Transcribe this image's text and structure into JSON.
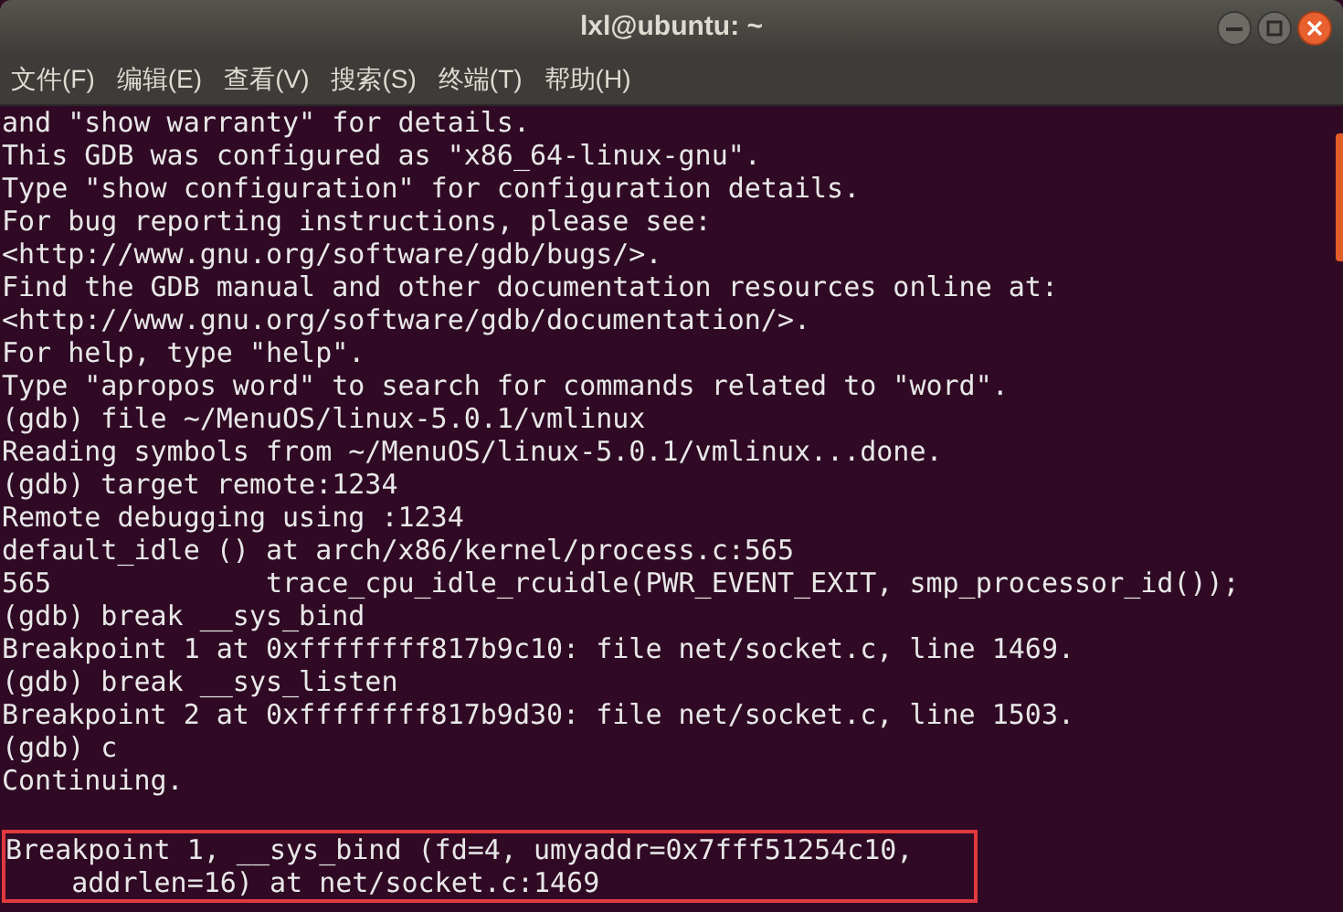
{
  "window": {
    "title": "lxl@ubuntu: ~"
  },
  "menu": [
    {
      "label": "文件(F)"
    },
    {
      "label": "编辑(E)"
    },
    {
      "label": "查看(V)"
    },
    {
      "label": "搜索(S)"
    },
    {
      "label": "终端(T)"
    },
    {
      "label": "帮助(H)"
    }
  ],
  "terminal": {
    "lines": [
      {
        "kind": "text",
        "text": "and \"show warranty\" for details."
      },
      {
        "kind": "text",
        "text": "This GDB was configured as \"x86_64-linux-gnu\"."
      },
      {
        "kind": "text",
        "text": "Type \"show configuration\" for configuration details."
      },
      {
        "kind": "text",
        "text": "For bug reporting instructions, please see:"
      },
      {
        "kind": "text",
        "text": "<http://www.gnu.org/software/gdb/bugs/>."
      },
      {
        "kind": "text",
        "text": "Find the GDB manual and other documentation resources online at:"
      },
      {
        "kind": "text",
        "text": "<http://www.gnu.org/software/gdb/documentation/>."
      },
      {
        "kind": "text",
        "text": "For help, type \"help\"."
      },
      {
        "kind": "text",
        "text": "Type \"apropos word\" to search for commands related to \"word\"."
      },
      {
        "kind": "text",
        "text": "(gdb) file ~/MenuOS/linux-5.0.1/vmlinux"
      },
      {
        "kind": "text",
        "text": "Reading symbols from ~/MenuOS/linux-5.0.1/vmlinux...done."
      },
      {
        "kind": "text",
        "text": "(gdb) target remote:1234"
      },
      {
        "kind": "text",
        "text": "Remote debugging using :1234"
      },
      {
        "kind": "text",
        "text": "default_idle () at arch/x86/kernel/process.c:565"
      },
      {
        "kind": "text",
        "text": "565\t\ttrace_cpu_idle_rcuidle(PWR_EVENT_EXIT, smp_processor_id());"
      },
      {
        "kind": "text",
        "text": "(gdb) break __sys_bind"
      },
      {
        "kind": "text",
        "text": "Breakpoint 1 at 0xffffffff817b9c10: file net/socket.c, line 1469."
      },
      {
        "kind": "text",
        "text": "(gdb) break __sys_listen"
      },
      {
        "kind": "text",
        "text": "Breakpoint 2 at 0xffffffff817b9d30: file net/socket.c, line 1503."
      },
      {
        "kind": "text",
        "text": "(gdb) c"
      },
      {
        "kind": "text",
        "text": "Continuing."
      },
      {
        "kind": "blank"
      }
    ],
    "highlighted_lines": [
      "Breakpoint 1, __sys_bind (fd=4, umyaddr=0x7fff51254c10,",
      "    addrlen=16) at net/socket.c:1469"
    ]
  }
}
